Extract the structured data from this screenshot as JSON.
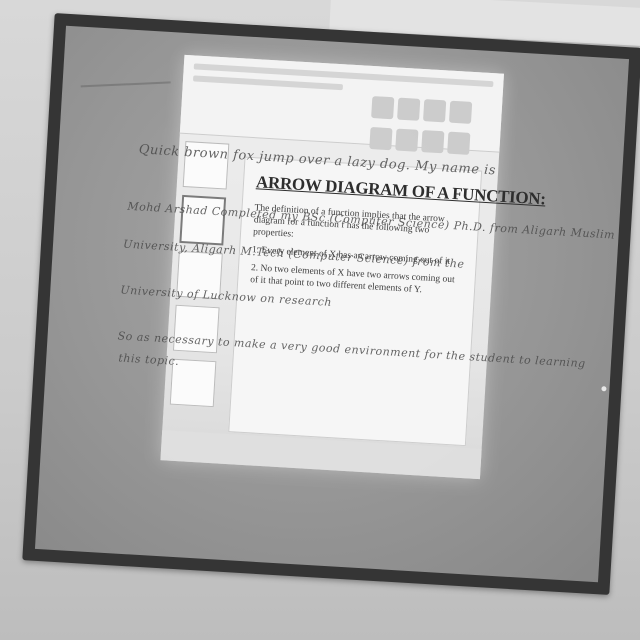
{
  "slide": {
    "title": "ARROW DIAGRAM OF A FUNCTION:",
    "paragraph": "The definition of a function implies that the arrow diagram for a function f has the following two properties:",
    "point1": "1. Every element of X has an arrow coming out of it",
    "point2": "2. No two elements of X have two arrows coming out of it that point to two different elements of Y."
  },
  "board_writing": {
    "line1": "Quick brown fox jump over a lazy dog. My name is",
    "line2": "Mohd Arshad  Completed my BSc (Computer Science)  Ph.D. from Aligarh Muslim",
    "line3": "University, Aligarh     M.Tech (Computer Science) from the",
    "line4": "University of Lucknow           on research",
    "line5": "So as necessary to make a very good environment for the student to learning",
    "line6": "this topic."
  }
}
